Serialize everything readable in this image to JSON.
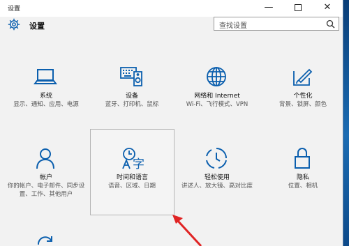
{
  "window": {
    "title": "设置",
    "minimize": "—",
    "close": "✕"
  },
  "header": {
    "title": "设置"
  },
  "search": {
    "placeholder": "查找设置"
  },
  "tiles": [
    {
      "title": "系统",
      "desc": "显示、通知、应用、电源"
    },
    {
      "title": "设备",
      "desc": "蓝牙、打印机、鼠标"
    },
    {
      "title": "网络和 Internet",
      "desc": "Wi-Fi、飞行模式、VPN"
    },
    {
      "title": "个性化",
      "desc": "背景、锁屏、颜色"
    },
    {
      "title": "帐户",
      "desc": "你的帐户、电子邮件、同步设置、工作、其他用户"
    },
    {
      "title": "时间和语言",
      "desc": "语音、区域、日期"
    },
    {
      "title": "轻松使用",
      "desc": "讲述人、放大镜、高对比度"
    },
    {
      "title": "隐私",
      "desc": "位置、相机"
    }
  ],
  "colors": {
    "accent": "#0b5fae",
    "arrow": "#e02424",
    "window_bg": "#f2f2f2"
  },
  "icons": [
    "gear-icon",
    "search-icon",
    "laptop-icon",
    "keyboard-speaker-icon",
    "globe-icon",
    "paint-brush-icon",
    "person-icon",
    "clock-language-icon",
    "accessibility-icon",
    "lock-icon",
    "update-icon"
  ]
}
